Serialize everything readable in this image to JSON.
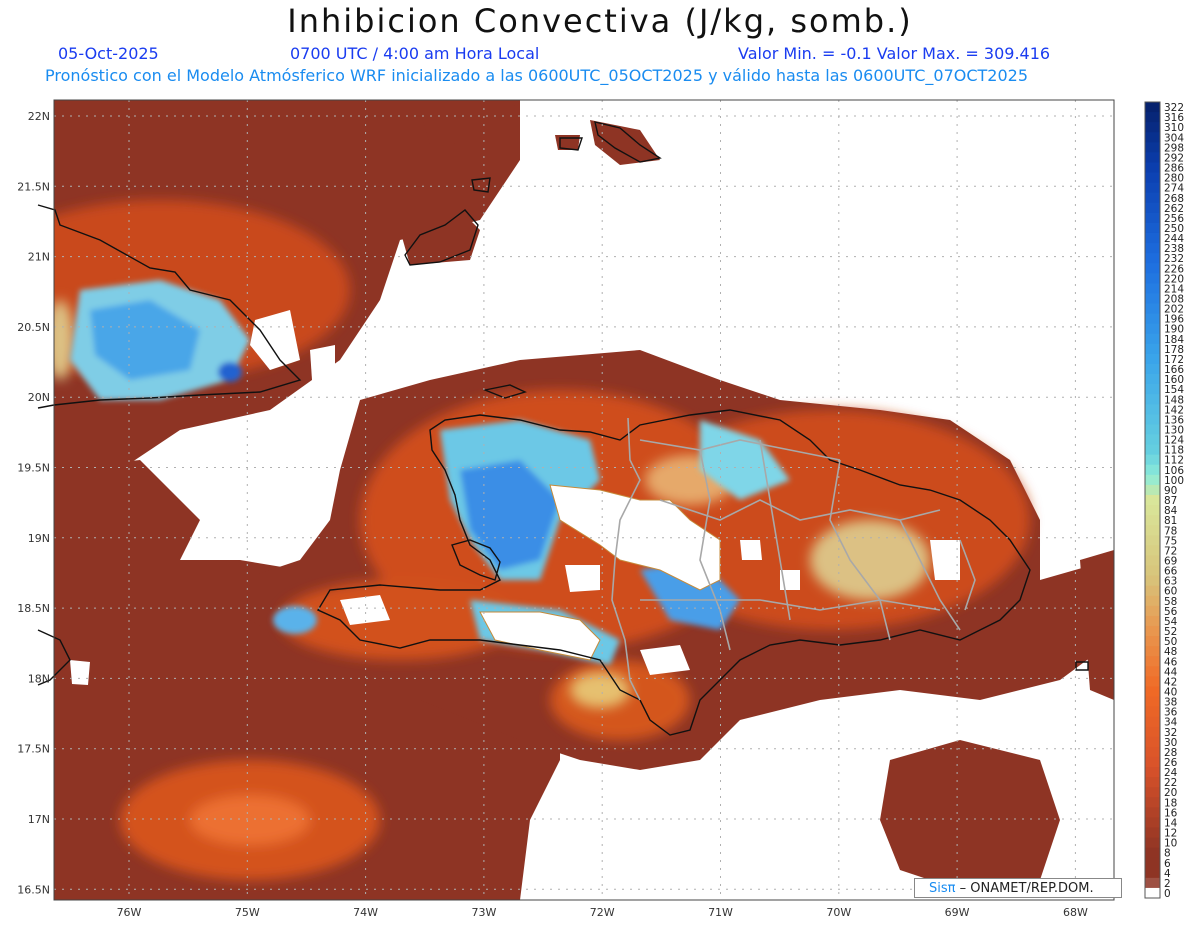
{
  "header": {
    "title": "Inhibicion Convectiva (J/kg, somb.)",
    "date": "05-Oct-2025",
    "time": "0700 UTC / 4:00 am Hora Local",
    "value_range": "Valor Min. = -0.1  Valor Max. = 309.416",
    "forecast_note": "Pronóstico con el Modelo Atmósferico WRF inicializado a las 0600UTC_05OCT2025 y válido hasta las  0600UTC_07OCT2025"
  },
  "map": {
    "lat_labels": [
      "22N",
      "21.5N",
      "21N",
      "20.5N",
      "20N",
      "19.5N",
      "19N",
      "18.5N",
      "18N",
      "17.5N",
      "17N",
      "16.5N"
    ],
    "lon_labels": [
      "76W",
      "75W",
      "74W",
      "73W",
      "72W",
      "71W",
      "70W",
      "69W",
      "68W"
    ],
    "colorbar_labels": [
      "322",
      "316",
      "310",
      "304",
      "298",
      "292",
      "286",
      "280",
      "274",
      "268",
      "262",
      "256",
      "250",
      "244",
      "238",
      "232",
      "226",
      "220",
      "214",
      "208",
      "202",
      "196",
      "190",
      "184",
      "178",
      "172",
      "166",
      "160",
      "154",
      "148",
      "142",
      "136",
      "130",
      "124",
      "118",
      "112",
      "106",
      "100",
      "90",
      "87",
      "84",
      "81",
      "78",
      "75",
      "72",
      "69",
      "66",
      "63",
      "60",
      "58",
      "56",
      "54",
      "52",
      "50",
      "48",
      "46",
      "44",
      "42",
      "40",
      "38",
      "36",
      "34",
      "32",
      "30",
      "28",
      "26",
      "24",
      "22",
      "20",
      "18",
      "16",
      "14",
      "12",
      "10",
      "8",
      "6",
      "4",
      "2",
      "0"
    ],
    "colors": {
      "ocean_base": "#8e3424",
      "mid_orange": "#d4521e",
      "bright_orange": "#ee6a24",
      "tan": "#dcc184",
      "cyan": "#7fd6e8",
      "blue": "#2f8fe6",
      "coast": "#111111",
      "border": "#a8a8a8"
    }
  },
  "credit": {
    "logo": "Sisπ",
    "text": "– ONAMET/REP.DOM."
  }
}
